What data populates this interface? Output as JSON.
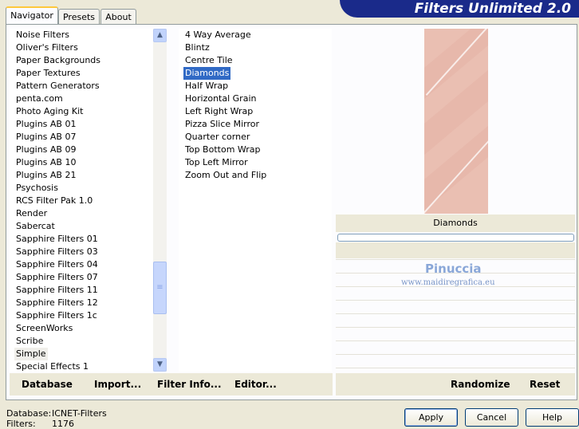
{
  "title": "Filters Unlimited 2.0",
  "tabs": [
    {
      "label": "Navigator",
      "active": true
    },
    {
      "label": "Presets",
      "active": false
    },
    {
      "label": "About",
      "active": false
    }
  ],
  "categories": [
    "Noise Filters",
    "Oliver's Filters",
    "Paper Backgrounds",
    "Paper Textures",
    "Pattern Generators",
    "penta.com",
    "Photo Aging Kit",
    "Plugins AB 01",
    "Plugins AB 07",
    "Plugins AB 09",
    "Plugins AB 10",
    "Plugins AB 21",
    "Psychosis",
    "RCS Filter Pak 1.0",
    "Render",
    "Sabercat",
    "Sapphire Filters 01",
    "Sapphire Filters 03",
    "Sapphire Filters 04",
    "Sapphire Filters 07",
    "Sapphire Filters 11",
    "Sapphire Filters 12",
    "Sapphire Filters 1c",
    "ScreenWorks",
    "Scribe",
    "Simple",
    "Special Effects 1"
  ],
  "selected_category": "Simple",
  "filters": [
    "4 Way Average",
    "Blintz",
    "Centre Tile",
    "Diamonds",
    "Half Wrap",
    "Horizontal Grain",
    "Left Right Wrap",
    "Pizza Slice Mirror",
    "Quarter corner",
    "Top Bottom Wrap",
    "Top Left Mirror",
    "Zoom Out and Flip"
  ],
  "selected_filter": "Diamonds",
  "preview": {
    "filter_name": "Diamonds",
    "progress": 0
  },
  "watermark": {
    "line1": "Pinuccia",
    "line2": "www.maidiregrafica.eu"
  },
  "toolbar": {
    "database": "Database",
    "import": "Import...",
    "filter_info": "Filter Info...",
    "editor": "Editor...",
    "randomize": "Randomize",
    "reset": "Reset"
  },
  "status": {
    "database_label": "Database:",
    "database_value": "ICNET-Filters",
    "filters_label": "Filters:",
    "filters_value": "1176"
  },
  "buttons": {
    "apply": "Apply",
    "cancel": "Cancel",
    "help": "Help"
  },
  "colors": {
    "banner": "#1a2a8a",
    "selection": "#316ac5",
    "preview": "#eabfb2"
  }
}
